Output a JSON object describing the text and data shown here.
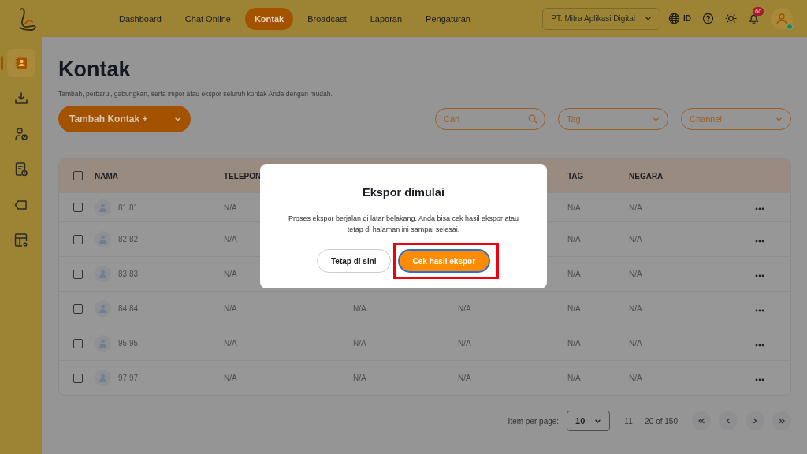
{
  "nav": {
    "items": [
      {
        "label": "Dashboard",
        "selected": false
      },
      {
        "label": "Chat Online",
        "selected": false
      },
      {
        "label": "Kontak",
        "selected": true
      },
      {
        "label": "Broadcast",
        "selected": false
      },
      {
        "label": "Laporan",
        "selected": false
      },
      {
        "label": "Pengaturan",
        "selected": false
      }
    ],
    "organization": "PT. Mitra Aplikasi Digital",
    "language": "ID",
    "notification_count": "60",
    "user_online": true
  },
  "sidebar": {
    "items": [
      {
        "kind": "contacts",
        "selected": true
      },
      {
        "kind": "import",
        "selected": false
      },
      {
        "kind": "user-block",
        "selected": false
      },
      {
        "kind": "schedule",
        "selected": false
      },
      {
        "kind": "tag",
        "selected": false
      },
      {
        "kind": "table-settings",
        "selected": false
      }
    ]
  },
  "page": {
    "title": "Kontak",
    "subtitle": "Tambah, perbarui, gabungkan, serta impor atau ekspor seluruh kontak Anda dengan mudah.",
    "add_button": "Tambah Kontak +"
  },
  "filters": {
    "search_placeholder": "Cari",
    "tag_placeholder": "Tag",
    "channel_placeholder": "Channel"
  },
  "table": {
    "select_all_checked": false,
    "columns": [
      {
        "label": "NAMA"
      },
      {
        "label": "TELEPON"
      },
      {
        "label": "TAG"
      },
      {
        "label": "NEGARA"
      }
    ],
    "rows": [
      {
        "checked": false,
        "name": "81 81",
        "phone": "N/A",
        "tag": "N/A",
        "country": "N/A"
      },
      {
        "checked": false,
        "name": "82 82",
        "phone": "N/A",
        "tag": "N/A",
        "country": "N/A"
      },
      {
        "checked": false,
        "name": "83 83",
        "phone": "N/A",
        "tag": "N/A",
        "country": "N/A"
      },
      {
        "checked": false,
        "name": "84 84",
        "phone": "N/A",
        "column_3": "N/A",
        "column_4": "N/A",
        "tag": "N/A",
        "country": "N/A"
      },
      {
        "checked": false,
        "name": "95 95",
        "phone": "N/A",
        "column_3": "N/A",
        "column_4": "N/A",
        "tag": "N/A",
        "country": "N/A"
      },
      {
        "checked": false,
        "name": "97 97",
        "phone": "N/A",
        "column_3": "N/A",
        "column_4": "N/A",
        "tag": "N/A",
        "country": "N/A"
      }
    ]
  },
  "pagination": {
    "label": "Item per page:",
    "per_page": "10",
    "range": "11 — 20 of 150"
  },
  "modal": {
    "title": "Ekspor dimulai",
    "message": "Proses ekspor berjalan di latar belakang. Anda bisa cek hasil ekspor atau tetap di halaman ini sampai selesai.",
    "buttons": [
      {
        "label": "Tetap di sini",
        "kind": "secondary",
        "highlighted": false
      },
      {
        "label": "Cek hasil ekspor",
        "kind": "primary",
        "highlighted": true
      }
    ]
  }
}
